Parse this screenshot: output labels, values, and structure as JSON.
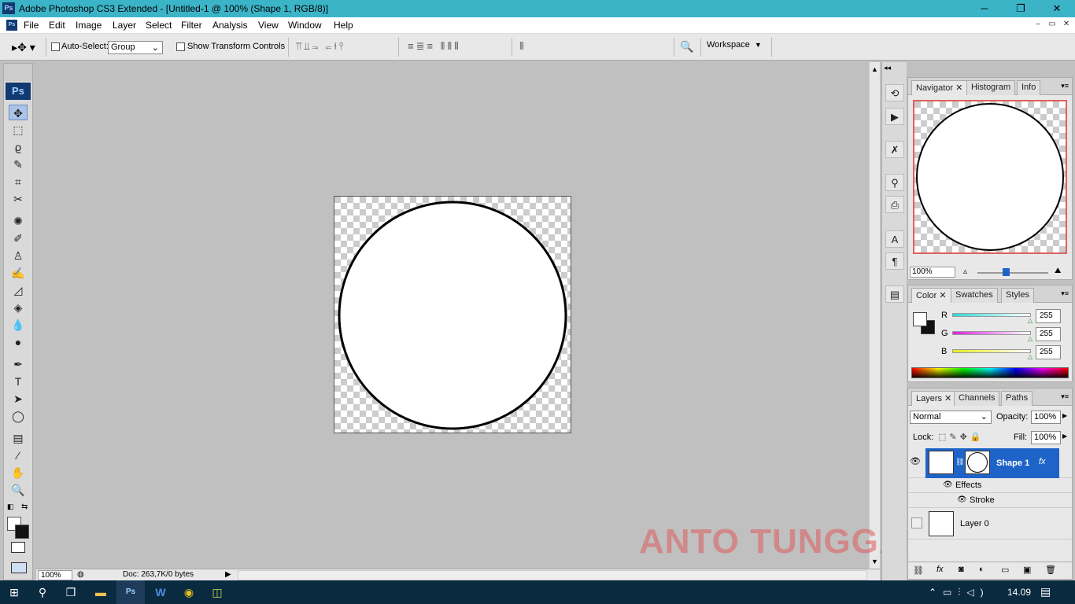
{
  "window": {
    "title": "Adobe Photoshop CS3 Extended - [Untitled-1 @ 100% (Shape 1, RGB/8)]",
    "app_icon": "Ps",
    "minimize": "─",
    "restore": "❐",
    "close": "✕"
  },
  "menu": {
    "items": [
      "File",
      "Edit",
      "Image",
      "Layer",
      "Select",
      "Filter",
      "Analysis",
      "View",
      "Window",
      "Help"
    ],
    "mdi_minimize": "–",
    "mdi_restore": "▭",
    "mdi_close": "✕"
  },
  "options_bar": {
    "auto_select_label": "Auto-Select:",
    "auto_select_value": "Group",
    "show_transform_label": "Show Transform Controls",
    "workspace_label": "Workspace"
  },
  "toolbox": {
    "logo": "Ps",
    "tools": [
      {
        "icon": "move-tool-icon",
        "glyph": "✥"
      },
      {
        "icon": "marquee-tool-icon",
        "glyph": "⬚"
      },
      {
        "icon": "lasso-tool-icon",
        "glyph": "ϱ"
      },
      {
        "icon": "magic-wand-tool-icon",
        "glyph": "✎"
      },
      {
        "icon": "crop-tool-icon",
        "glyph": "⌗"
      },
      {
        "icon": "slice-tool-icon",
        "glyph": "✂"
      },
      {
        "icon": "healing-brush-tool-icon",
        "glyph": "✺"
      },
      {
        "icon": "brush-tool-icon",
        "glyph": "✐"
      },
      {
        "icon": "clone-stamp-tool-icon",
        "glyph": "♙"
      },
      {
        "icon": "history-brush-tool-icon",
        "glyph": "✍"
      },
      {
        "icon": "eraser-tool-icon",
        "glyph": "◿"
      },
      {
        "icon": "paint-bucket-tool-icon",
        "glyph": "◈"
      },
      {
        "icon": "blur-tool-icon",
        "glyph": "💧"
      },
      {
        "icon": "dodge-tool-icon",
        "glyph": "●"
      },
      {
        "icon": "pen-tool-icon",
        "glyph": "✒"
      },
      {
        "icon": "type-tool-icon",
        "glyph": "T"
      },
      {
        "icon": "path-selection-tool-icon",
        "glyph": "➤"
      },
      {
        "icon": "ellipse-tool-icon",
        "glyph": "◯"
      },
      {
        "icon": "notes-tool-icon",
        "glyph": "▤"
      },
      {
        "icon": "eyedropper-tool-icon",
        "glyph": "⁄"
      },
      {
        "icon": "hand-tool-icon",
        "glyph": "✋"
      },
      {
        "icon": "zoom-tool-icon",
        "glyph": "🔍"
      }
    ]
  },
  "status_bar": {
    "zoom": "100%",
    "doc_info": "Doc: 263,7K/0 bytes"
  },
  "navigator_panel": {
    "tabs": [
      "Navigator",
      "Histogram",
      "Info"
    ],
    "zoom": "100%"
  },
  "color_panel": {
    "tabs": [
      "Color",
      "Swatches",
      "Styles"
    ],
    "channels": [
      {
        "label": "R",
        "value": "255",
        "color": "#2fd8d8"
      },
      {
        "label": "G",
        "value": "255",
        "color": "#e020e0"
      },
      {
        "label": "B",
        "value": "255",
        "color": "#e8e820"
      }
    ]
  },
  "layers_panel": {
    "tabs": [
      "Layers",
      "Channels",
      "Paths"
    ],
    "blend_mode": "Normal",
    "opacity_label": "Opacity:",
    "opacity_value": "100%",
    "lock_label": "Lock:",
    "fill_label": "Fill:",
    "fill_value": "100%",
    "layers": [
      {
        "name": "Shape 1",
        "selected": true,
        "fx": "fx"
      },
      {
        "name": "Effects"
      },
      {
        "name": "Stroke"
      },
      {
        "name": "Layer 0"
      }
    ],
    "accent": "#1e64c8"
  },
  "taskbar": {
    "time": "14.09",
    "apps": [
      "start-icon",
      "search-icon",
      "task-view-icon",
      "file-explorer-icon",
      "photoshop-icon",
      "word-icon",
      "chrome-icon",
      "app-icon"
    ]
  },
  "watermark": "ANTO TUNGGAL"
}
